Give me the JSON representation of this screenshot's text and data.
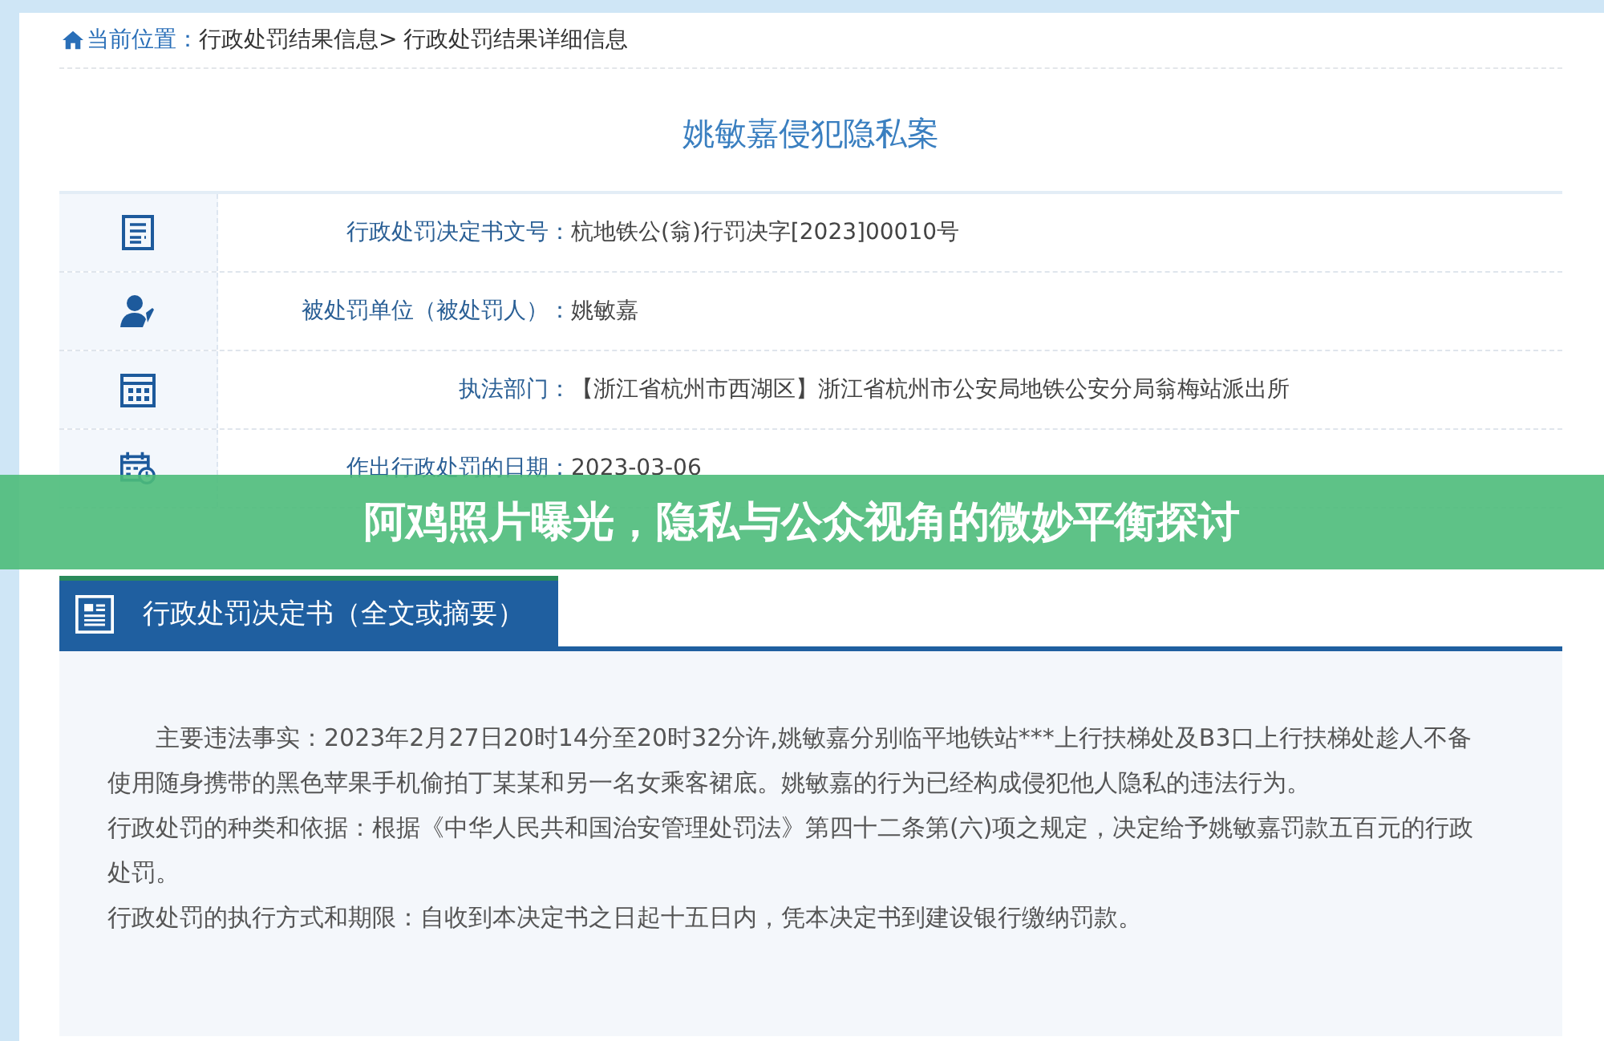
{
  "breadcrumb": {
    "label": "当前位置：",
    "separator": ">",
    "items": [
      "行政处罚结果信息",
      "行政处罚结果详细信息"
    ]
  },
  "title": "姚敏嘉侵犯隐私案",
  "fields": [
    {
      "kind": "document",
      "label": "行政处罚决定书文号：",
      "value": "杭地铁公(翁)行罚决字[2023]00010号"
    },
    {
      "kind": "person",
      "label": "被处罚单位（被处罚人）：",
      "value": "姚敏嘉"
    },
    {
      "kind": "building",
      "label": "执法部门：",
      "value": "【浙江省杭州市西湖区】浙江省杭州市公安局地铁公安分局翁梅站派出所"
    },
    {
      "kind": "calendar",
      "label": "作出行政处罚的日期：",
      "value": "2023-03-06"
    }
  ],
  "section": {
    "title": "行政处罚决定书（全文或摘要）",
    "paragraphs": [
      {
        "indent": true,
        "text": "主要违法事实：2023年2月27日20时14分至20时32分许,姚敏嘉分别临平地铁站***上行扶梯处及B3口上行扶梯处趁人不备使用随身携带的黑色苹果手机偷拍丁某某和另一名女乘客裙底。姚敏嘉的行为已经构成侵犯他人隐私的违法行为。"
      },
      {
        "indent": false,
        "text": "行政处罚的种类和依据：根据《中华人民共和国治安管理处罚法》第四十二条第(六)项之规定，决定给予姚敏嘉罚款五百元的行政处罚。"
      },
      {
        "indent": false,
        "text": "行政处罚的执行方式和期限：自收到本决定书之日起十五日内，凭本决定书到建设银行缴纳罚款。"
      }
    ]
  },
  "banner": {
    "title": "阿鸡照片曝光，隐私与公众视角的微妙平衡探讨"
  }
}
